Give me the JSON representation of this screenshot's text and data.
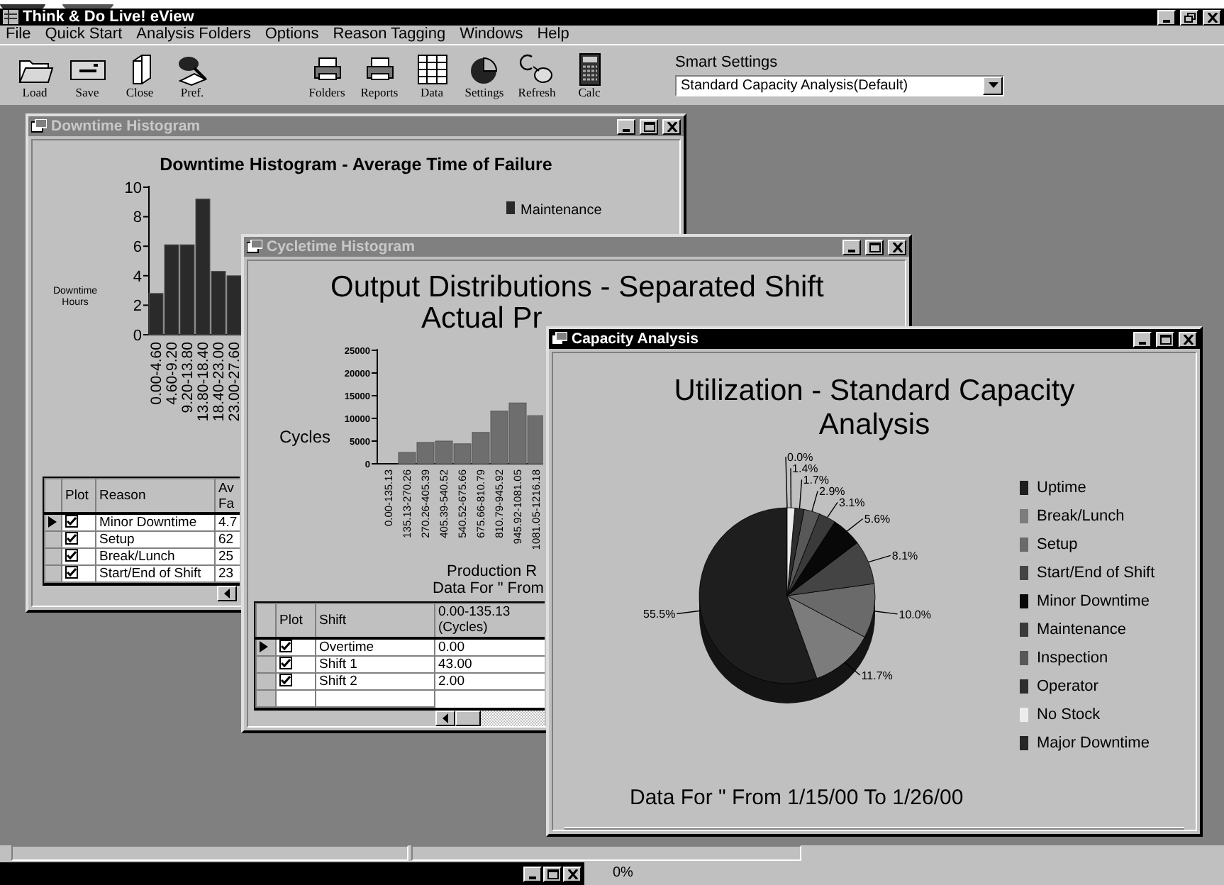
{
  "app": {
    "title": "Think & Do Live! eView"
  },
  "menu": [
    "File",
    "Quick Start",
    "Analysis Folders",
    "Options",
    "Reason Tagging",
    "Windows",
    "Help"
  ],
  "toolbar": {
    "left": [
      {
        "label": "Load"
      },
      {
        "label": "Save"
      },
      {
        "label": "Close"
      },
      {
        "label": "Pref."
      }
    ],
    "right": [
      {
        "label": "Folders"
      },
      {
        "label": "Reports"
      },
      {
        "label": "Data"
      },
      {
        "label": "Settings"
      },
      {
        "label": "Refresh"
      },
      {
        "label": "Calc"
      }
    ]
  },
  "smart_settings": {
    "label": "Smart Settings",
    "value": "Standard Capacity Analysis(Default)"
  },
  "windows": [
    {
      "kind": "histogram",
      "title": "Downtime Histogram",
      "active": false,
      "chart_data": {
        "type": "bar",
        "title": "Downtime Histogram - Average Time of Failure",
        "ylabel": "Downtime Hours",
        "categories": [
          "0.00-4.60",
          "4.60-9.20",
          "9.20-13.80",
          "13.80-18.40",
          "18.40-23.00",
          "23.00-27.60"
        ],
        "series": [
          {
            "name": "Maintenance",
            "color": "#2a2a2a",
            "values": [
              2.8,
              6.1,
              6.1,
              9.2,
              4.3,
              4.0
            ]
          }
        ],
        "ylim": [
          0,
          10
        ],
        "yticks": [
          0,
          2,
          4,
          6,
          8,
          10
        ]
      },
      "table": {
        "plot_header": "Plot",
        "columns": [
          "Reason",
          "Av\nFa"
        ],
        "rows": [
          {
            "selected": true,
            "plot": true,
            "cells": [
              "Minor Downtime",
              "4.7"
            ]
          },
          {
            "selected": false,
            "plot": true,
            "cells": [
              "Setup",
              "62"
            ]
          },
          {
            "selected": false,
            "plot": true,
            "cells": [
              "Break/Lunch",
              "25"
            ]
          },
          {
            "selected": false,
            "plot": true,
            "cells": [
              "Start/End of Shift",
              "23"
            ]
          }
        ]
      }
    },
    {
      "kind": "histogram",
      "title": "Cycletime Histogram",
      "active": false,
      "chart_data": {
        "type": "bar",
        "title": "Output Distributions - Separated Shift",
        "subtitle": "Actual Pr",
        "ylabel": "Cycles",
        "xlabel": "Production R",
        "categories": [
          "0.00-135.13",
          "135.13-270.26",
          "270.26-405.39",
          "405.39-540.52",
          "540.52-675.66",
          "675.66-810.79",
          "810.79-945.92",
          "945.92-1081.05",
          "1081.05-1216.18"
        ],
        "series": [
          {
            "color": "#6e6e6e",
            "values": [
              0,
              2500,
              4700,
              5000,
              4400,
              6900,
              11600,
              13400,
              10600
            ]
          }
        ],
        "ylim": [
          0,
          25000
        ],
        "yticks": [
          0,
          5000,
          10000,
          15000,
          20000,
          25000
        ],
        "annotations": [
          "Data For \" From"
        ]
      },
      "table": {
        "plot_header": "Plot",
        "columns": [
          "Shift",
          "0.00-135.13\n(Cycles)"
        ],
        "new_row": true,
        "rows": [
          {
            "selected": true,
            "plot": true,
            "cells": [
              "Overtime",
              "0.00"
            ]
          },
          {
            "selected": false,
            "plot": true,
            "cells": [
              "Shift 1",
              "43.00"
            ]
          },
          {
            "selected": false,
            "plot": true,
            "cells": [
              "Shift 2",
              "2.00"
            ]
          }
        ]
      }
    },
    {
      "kind": "pie",
      "title": "Capacity Analysis",
      "active": true,
      "chart_data": {
        "type": "pie",
        "title": "Utilization - Standard Capacity Analysis",
        "categories": [
          "Uptime",
          "Break/Lunch",
          "Setup",
          "Start/End of Shift",
          "Minor Downtime",
          "Maintenance",
          "Inspection",
          "Operator",
          "No Stock",
          "Major Downtime"
        ],
        "values": [
          55.5,
          11.7,
          10.0,
          8.1,
          5.6,
          3.1,
          2.9,
          1.7,
          1.4,
          0.0
        ],
        "colors": [
          "#1e1e1e",
          "#7c7c7c",
          "#6a6a6a",
          "#444444",
          "#080808",
          "#3a3a3a",
          "#585858",
          "#2e2e2e",
          "#ececec",
          "#262626"
        ],
        "value_labels": [
          "55.5%",
          "11.7%",
          "10.0%",
          "8.1%",
          "5.6%",
          "3.1%",
          "2.9%",
          "1.7%",
          "1.4%",
          "0.0%"
        ],
        "annotations": [
          "Data For \" From 1/15/00 To 1/26/00"
        ]
      }
    }
  ],
  "status_bar": {
    "progress_text": "0%"
  }
}
